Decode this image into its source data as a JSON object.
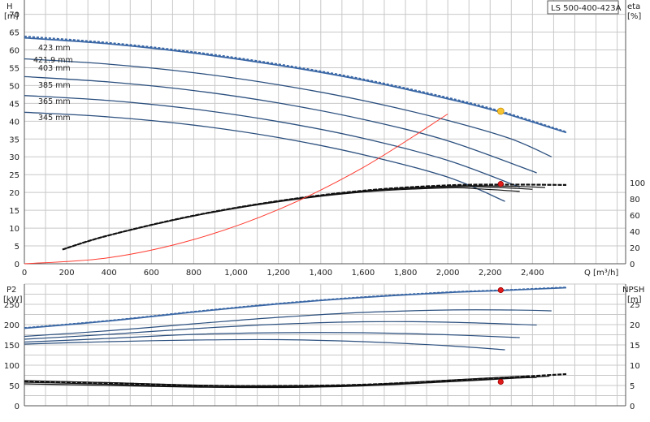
{
  "model_label": "LS 500-400-423A",
  "colors": {
    "curve": "#2b4f7e",
    "dashed": "#3a67a5",
    "black": "#111111",
    "system": "#ff3b30",
    "duty_h": "#f7c531",
    "duty_other": "#e01b1b"
  },
  "chart_data": [
    {
      "type": "line",
      "title": "",
      "x_label": "Q [m³/h]",
      "y_left_label": [
        "H",
        "[m]"
      ],
      "y_right_label": [
        "eta",
        "[%]"
      ],
      "x_ticks": [
        "0",
        "200",
        "400",
        "600",
        "800",
        "1,000",
        "1,200",
        "1,400",
        "1,600",
        "1,800",
        "2,000",
        "2,200",
        "2,400"
      ],
      "y_left_ticks": [
        "0",
        "5",
        "10",
        "15",
        "20",
        "25",
        "30",
        "35",
        "40",
        "45",
        "50",
        "55",
        "60",
        "65",
        "70"
      ],
      "y_right_ticks": [
        "0",
        "20",
        "40",
        "60",
        "80",
        "100"
      ],
      "xlim": [
        0,
        2840
      ],
      "ylim_left": [
        0,
        74
      ],
      "ylim_right": [
        0,
        100
      ],
      "grid": true,
      "head_curves": [
        {
          "name": "423 mm",
          "x": [
            0,
            400,
            800,
            1200,
            1600,
            2000,
            2250,
            2560
          ],
          "y": [
            63.8,
            62.0,
            59.4,
            56.0,
            51.8,
            46.6,
            42.8,
            37.0
          ]
        },
        {
          "name": "421.9 mm",
          "x": [
            0,
            400,
            800,
            1200,
            1600,
            2000,
            2250,
            2560
          ],
          "y": [
            63.4,
            61.7,
            59.1,
            55.7,
            51.5,
            46.3,
            42.5,
            36.8
          ]
        },
        {
          "name": "403 mm",
          "x": [
            0,
            400,
            800,
            1200,
            1600,
            2000,
            2300,
            2490
          ],
          "y": [
            57.5,
            56.0,
            53.6,
            50.2,
            45.8,
            40.2,
            35.0,
            30.0
          ]
        },
        {
          "name": "385 mm",
          "x": [
            0,
            400,
            800,
            1200,
            1600,
            2000,
            2420
          ],
          "y": [
            52.5,
            51.0,
            48.6,
            45.1,
            40.5,
            34.5,
            25.5
          ]
        },
        {
          "name": "365 mm",
          "x": [
            0,
            400,
            800,
            1200,
            1600,
            2000,
            2340
          ],
          "y": [
            47.2,
            45.8,
            43.4,
            39.9,
            35.2,
            29.0,
            21.5
          ]
        },
        {
          "name": "345 mm",
          "x": [
            0,
            400,
            800,
            1200,
            1600,
            2000,
            2270
          ],
          "y": [
            42.5,
            41.2,
            38.9,
            35.4,
            30.6,
            24.3,
            17.5
          ]
        }
      ],
      "efficiency_curves": [
        {
          "x": [
            180,
            400,
            800,
            1200,
            1600,
            2000,
            2300,
            2560
          ],
          "y": [
            4.0,
            8.0,
            13.5,
            17.6,
            20.5,
            22.0,
            22.2,
            22.1
          ]
        },
        {
          "x": [
            180,
            400,
            800,
            1200,
            1600,
            2000,
            2250,
            2460
          ],
          "y": [
            4.0,
            8.0,
            13.5,
            17.6,
            20.4,
            21.8,
            21.8,
            21.4
          ]
        },
        {
          "x": [
            180,
            400,
            800,
            1200,
            1600,
            2000,
            2200,
            2400
          ],
          "y": [
            4.0,
            8.0,
            13.4,
            17.5,
            20.3,
            21.6,
            21.5,
            20.9
          ]
        },
        {
          "x": [
            180,
            400,
            800,
            1200,
            1600,
            2000,
            2150,
            2340
          ],
          "y": [
            4.0,
            8.0,
            13.4,
            17.4,
            20.1,
            21.3,
            21.0,
            20.3
          ]
        }
      ],
      "system_curve": {
        "x": [
          0,
          400,
          800,
          1200,
          1600,
          2000,
          2250
        ],
        "y": [
          0,
          1.7,
          6.8,
          15.2,
          27.0,
          42.0,
          42.8
        ]
      },
      "duty_points": [
        {
          "x": 2250,
          "y": 42.8,
          "role": "head"
        },
        {
          "x": 2250,
          "y": 22.4,
          "role": "efficiency"
        }
      ],
      "curve_labels": [
        "423 mm",
        "421.9 mm",
        "403 mm",
        "385 mm",
        "365 mm",
        "345 mm"
      ]
    },
    {
      "type": "line",
      "title": "",
      "y_left_label": [
        "P2",
        "[kW]"
      ],
      "y_right_label": [
        "NPSH",
        "[m]"
      ],
      "y_left_ticks": [
        "0",
        "50",
        "100",
        "150",
        "200",
        "250"
      ],
      "y_right_ticks": [
        "0",
        "5",
        "10",
        "15",
        "20",
        "25"
      ],
      "xlim": [
        0,
        2840
      ],
      "ylim_left": [
        0,
        300
      ],
      "grid": true,
      "power_curves": [
        {
          "x": [
            0,
            400,
            800,
            1200,
            1600,
            2000,
            2250,
            2560
          ],
          "y": [
            192,
            210,
            232,
            252,
            268,
            280,
            285,
            292
          ]
        },
        {
          "x": [
            0,
            400,
            800,
            1200,
            1600,
            2000,
            2250,
            2560
          ],
          "y": [
            191,
            209,
            231,
            251,
            267,
            279,
            284,
            291
          ]
        },
        {
          "x": [
            0,
            400,
            800,
            1200,
            1600,
            2000,
            2300,
            2490
          ],
          "y": [
            171,
            185,
            202,
            218,
            230,
            236,
            236,
            234
          ]
        },
        {
          "x": [
            0,
            400,
            800,
            1200,
            1600,
            2000,
            2420
          ],
          "y": [
            164,
            176,
            190,
            201,
            207,
            206,
            199
          ]
        },
        {
          "x": [
            0,
            400,
            800,
            1200,
            1600,
            2000,
            2340
          ],
          "y": [
            157,
            166,
            176,
            180,
            180,
            175,
            168
          ]
        },
        {
          "x": [
            0,
            400,
            800,
            1200,
            1600,
            2000,
            2270
          ],
          "y": [
            152,
            158,
            162,
            163,
            158,
            148,
            138
          ]
        }
      ],
      "npsh_curves": [
        {
          "x": [
            0,
            400,
            800,
            1200,
            1600,
            2000,
            2250,
            2560
          ],
          "y": [
            6.0,
            5.6,
            5.0,
            4.9,
            5.2,
            6.2,
            6.9,
            7.8
          ]
        },
        {
          "x": [
            0,
            400,
            800,
            1200,
            1600,
            2000,
            2250,
            2480
          ],
          "y": [
            5.4,
            5.0,
            4.6,
            4.5,
            4.9,
            5.9,
            6.6,
            7.3
          ]
        },
        {
          "x": [
            0,
            400,
            800,
            1200,
            1600,
            2000,
            2250,
            2420
          ],
          "y": [
            5.8,
            5.3,
            4.8,
            4.7,
            5.0,
            6.0,
            6.7,
            7.0
          ]
        },
        {
          "x": [
            0,
            400,
            800,
            1200,
            1600,
            2000,
            2250,
            2380
          ],
          "y": [
            6.2,
            5.7,
            5.1,
            4.9,
            5.2,
            6.3,
            7.0,
            7.3
          ]
        }
      ],
      "duty_points": [
        {
          "x": 2250,
          "y": 285,
          "role": "power"
        },
        {
          "x": 2250,
          "y": 5.9,
          "role": "npsh"
        }
      ]
    }
  ]
}
